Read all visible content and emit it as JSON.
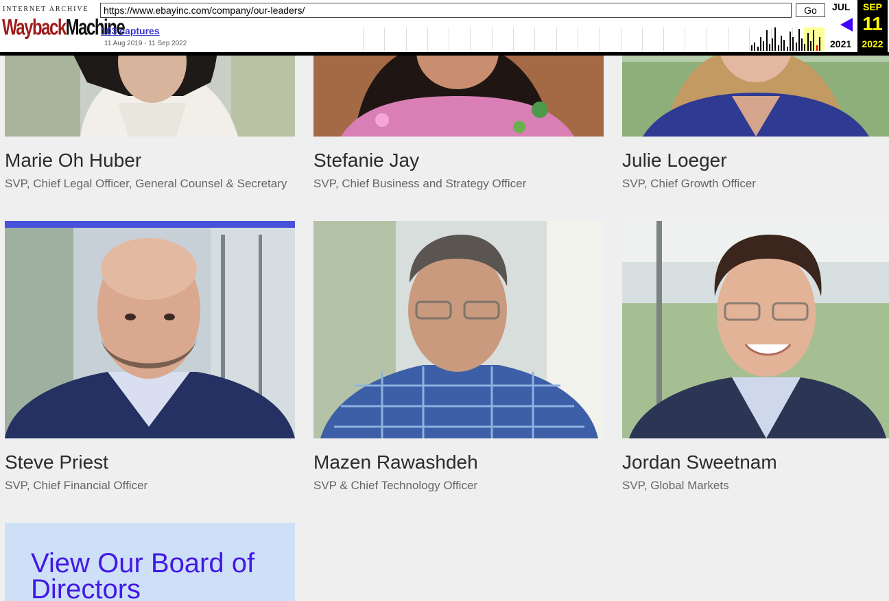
{
  "wayback": {
    "logo_top": "INTERNET ARCHIVE",
    "logo_word_1": "Wayback",
    "logo_word_2": "Machine",
    "url": "https://www.ebayinc.com/company/our-leaders/",
    "go_label": "Go",
    "captures": "103 captures",
    "date_range": "11 Aug 2019 - 11 Sep 2022",
    "prev_month": "JUL",
    "prev_year": "2021",
    "current_month": "SEP",
    "current_day": "11",
    "current_year": "2022",
    "colors": {
      "current_bg": "#000000",
      "current_text": "#ffff00",
      "arrow": "#3f00ff"
    }
  },
  "leaders": [
    {
      "name": "Marie Oh Huber",
      "title": "SVP, Chief Legal Officer, General Counsel & Secretary"
    },
    {
      "name": "Stefanie Jay",
      "title": "SVP, Chief Business and Strategy Officer"
    },
    {
      "name": "Julie Loeger",
      "title": "SVP, Chief Growth Officer"
    },
    {
      "name": "Steve Priest",
      "title": "SVP, Chief Financial Officer"
    },
    {
      "name": "Mazen Rawashdeh",
      "title": "SVP & Chief Technology Officer"
    },
    {
      "name": "Jordan Sweetnam",
      "title": "SVP, Global Markets"
    }
  ],
  "board": {
    "link_text": "View Our Board of Directors"
  },
  "colors": {
    "accent": "#4751d9",
    "board_bg": "#cde0f7",
    "board_link": "#4318e6"
  }
}
